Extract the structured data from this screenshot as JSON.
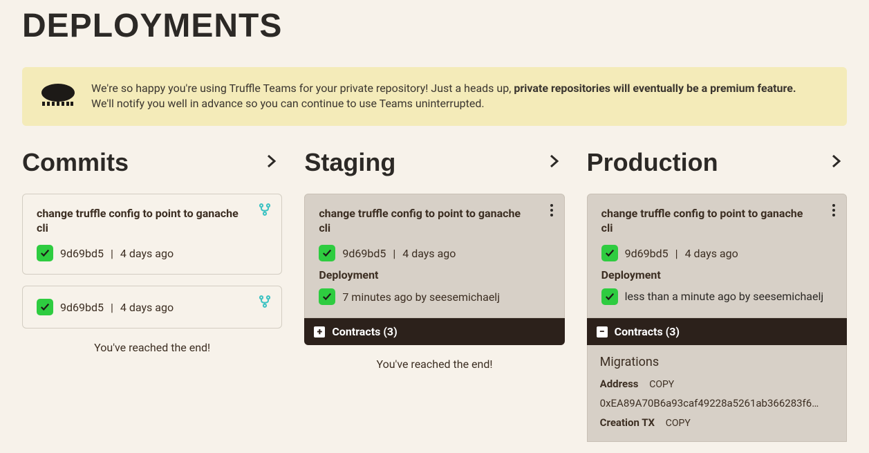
{
  "page_title": "DEPLOYMENTS",
  "banner": {
    "text_pre": "We're so happy you're using Truffle Teams for your private repository! Just a heads up, ",
    "text_bold": "private repositories will eventually be a premium feature.",
    "text_post": " We'll notify you well in advance so you can continue to use Teams uninterrupted."
  },
  "columns": {
    "commits": {
      "title": "Commits",
      "cards": [
        {
          "title": "change truffle config to point to ganache cli",
          "hash": "9d69bd5",
          "age": "4 days ago"
        },
        {
          "title": "",
          "hash": "9d69bd5",
          "age": "4 days ago"
        }
      ],
      "end": "You've reached the end!"
    },
    "staging": {
      "title": "Staging",
      "card": {
        "title": "change truffle config to point to ganache cli",
        "hash": "9d69bd5",
        "age": "4 days ago",
        "deployment_label": "Deployment",
        "deployment_meta": "7 minutes ago by seesemichaelj",
        "contracts_label": "Contracts (3)"
      },
      "end": "You've reached the end!"
    },
    "production": {
      "title": "Production",
      "card": {
        "title": "change truffle config to point to ganache cli",
        "hash": "9d69bd5",
        "age": "4 days ago",
        "deployment_label": "Deployment",
        "deployment_meta": "less than a minute ago by seesemichaelj",
        "contracts_label": "Contracts (3)"
      },
      "details": {
        "name": "Migrations",
        "address_label": "Address",
        "copy": "COPY",
        "address": "0xEA89A70B6a93caf49228a5261ab366283f6…",
        "creation_label": "Creation TX"
      }
    }
  }
}
